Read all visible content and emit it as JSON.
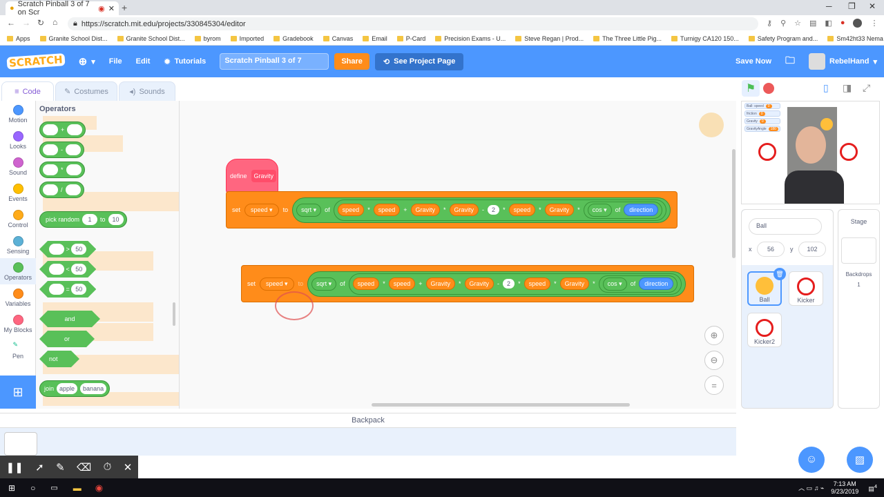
{
  "browser": {
    "tab_title": "Scratch Pinball 3 of 7 on Scr",
    "url": "https://scratch.mit.edu/projects/330845304/editor",
    "bookmarks": [
      "Apps",
      "Granite School Dist...",
      "Granite School Dist...",
      "byrom",
      "Imported",
      "Gradebook",
      "Canvas",
      "Email",
      "P-Card",
      "Precision Exams - U...",
      "Steve Regan | Prod...",
      "The Three Little Pig...",
      "Turnigy CA120 150...",
      "Safety Program and...",
      "Sm42ht33 Nema 17..."
    ]
  },
  "menubar": {
    "logo": "SCRATCH",
    "file": "File",
    "edit": "Edit",
    "tutorials": "Tutorials",
    "project_title": "Scratch Pinball 3 of 7",
    "share": "Share",
    "see_project_page": "See Project Page",
    "save_now": "Save Now",
    "username": "RebelHand"
  },
  "editor_tabs": {
    "code": "Code",
    "costumes": "Costumes",
    "sounds": "Sounds"
  },
  "categories": [
    {
      "label": "Motion",
      "color": "#4c97ff"
    },
    {
      "label": "Looks",
      "color": "#9966ff"
    },
    {
      "label": "Sound",
      "color": "#cf63cf"
    },
    {
      "label": "Events",
      "color": "#ffbf00"
    },
    {
      "label": "Control",
      "color": "#ffab19"
    },
    {
      "label": "Sensing",
      "color": "#5cb1d6"
    },
    {
      "label": "Operators",
      "color": "#59c059"
    },
    {
      "label": "Variables",
      "color": "#ff8c1a"
    },
    {
      "label": "My Blocks",
      "color": "#ff6680"
    },
    {
      "label": "Pen",
      "color": ""
    }
  ],
  "palette": {
    "heading": "Operators",
    "plus": "+",
    "minus": "-",
    "times": "*",
    "divide": "/",
    "pick_random": "pick random",
    "to": "to",
    "rand_from": "1",
    "rand_to": "10",
    "gt": ">",
    "lt": "<",
    "eq": "=",
    "fifty": "50",
    "and": "and",
    "or": "or",
    "not": "not",
    "join": "join",
    "apple": "apple",
    "banana": "banana"
  },
  "script1": {
    "define": "define",
    "define_name": "Gravity",
    "set": "set",
    "var": "speed",
    "to": "to",
    "sqrt": "sqrt",
    "of": "of",
    "terms": [
      "speed",
      "*",
      "speed",
      "+",
      "Gravity",
      "*",
      "Gravity",
      "-",
      "2",
      "*",
      "speed",
      "*",
      "Gravity",
      "*"
    ],
    "cos": "cos",
    "direction": "direction"
  },
  "script2": {
    "set": "set",
    "var": "speed",
    "to": "to",
    "sqrt": "sqrt",
    "of": "of",
    "cos": "cos",
    "direction": "direction"
  },
  "stage": {
    "monitors": [
      {
        "label": "Ball: speed",
        "value": "0"
      },
      {
        "label": "friction",
        "value": "0"
      },
      {
        "label": "Gravity",
        "value": "0"
      },
      {
        "label": "GravityAngle",
        "value": "180"
      }
    ]
  },
  "sprite_info": {
    "name": "Ball",
    "x_label": "x",
    "x": "56",
    "y_label": "y",
    "y": "102"
  },
  "sprites": [
    "Ball",
    "Kicker",
    "Kicker2"
  ],
  "stage_panel": {
    "title": "Stage",
    "backdrops_label": "Backdrops",
    "backdrops_count": "1"
  },
  "backpack": "Backpack",
  "taskbar": {
    "time": "7:13 AM",
    "date": "9/23/2019",
    "notif": "4"
  }
}
